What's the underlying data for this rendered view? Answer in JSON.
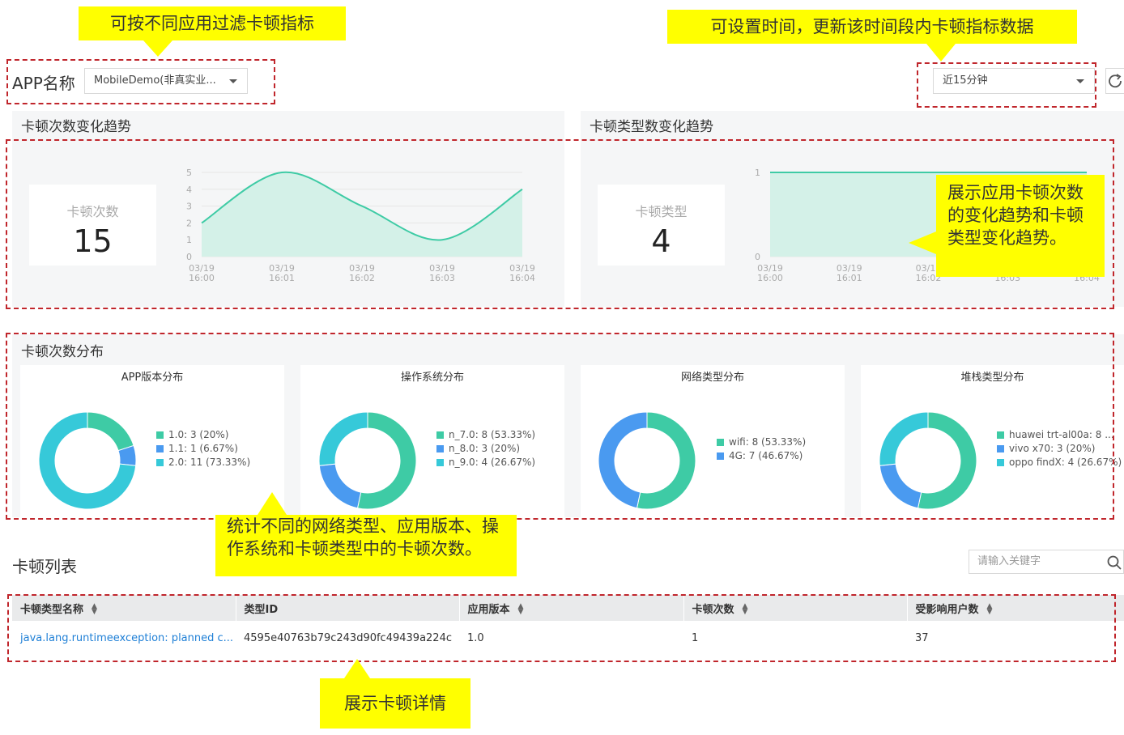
{
  "callouts": {
    "app_filter": "可按不同应用过滤卡顿指标",
    "time_filter": "可设置时间，更新该时间段内卡顿指标数据",
    "trends": "展示应用卡顿次数的变化趋势和卡顿类型变化趋势。",
    "distribution": "统计不同的网络类型、应用版本、操作系统和卡顿类型中的卡顿次数。",
    "details": "展示卡顿详情"
  },
  "header": {
    "app_label": "APP名称",
    "app_select": "MobileDemo(非真实业...",
    "time_select": "近15分钟",
    "refresh_icon": "refresh-icon"
  },
  "trend_count": {
    "title": "卡顿次数变化趋势",
    "kpi_label": "卡顿次数",
    "kpi_value": "15",
    "y_ticks": [
      "5",
      "4",
      "3",
      "2",
      "1",
      "0"
    ],
    "x_ticks": [
      {
        "date": "03/19",
        "time": "16:00"
      },
      {
        "date": "03/19",
        "time": "16:01"
      },
      {
        "date": "03/19",
        "time": "16:02"
      },
      {
        "date": "03/19",
        "time": "16:03"
      },
      {
        "date": "03/19",
        "time": "16:04"
      }
    ]
  },
  "trend_type": {
    "title": "卡顿类型数变化趋势",
    "kpi_label": "卡顿类型",
    "kpi_value": "4",
    "y_ticks": [
      "1",
      "0"
    ],
    "x_ticks": [
      {
        "date": "03/19",
        "time": "16:00"
      },
      {
        "date": "03/19",
        "time": "16:01"
      },
      {
        "date": "03/19",
        "time": "16:02"
      },
      {
        "date": "03/19",
        "time": "16:03"
      },
      {
        "date": "03/19",
        "time": "16:04"
      }
    ]
  },
  "distribution": {
    "title": "卡顿次数分布",
    "cards": [
      {
        "title": "APP版本分布",
        "legend": [
          "1.0: 3 (20%)",
          "1.1: 1 (6.67%)",
          "2.0: 11 (73.33%)"
        ]
      },
      {
        "title": "操作系统分布",
        "legend": [
          "n_7.0: 8 (53.33%)",
          "n_8.0: 3 (20%)",
          "n_9.0: 4 (26.67%)"
        ]
      },
      {
        "title": "网络类型分布",
        "legend": [
          "wifi: 8 (53.33%)",
          "4G: 7 (46.67%)"
        ]
      },
      {
        "title": "堆栈类型分布",
        "legend": [
          "huawei trt-al00a: 8 ...",
          "vivo x70: 3 (20%)",
          "oppo findX: 4 (26.67%)"
        ]
      }
    ]
  },
  "list": {
    "title": "卡顿列表",
    "search_placeholder": "请输入关键字",
    "columns": [
      "卡顿类型名称",
      "类型ID",
      "应用版本",
      "卡顿次数",
      "受影响用户数"
    ],
    "rows": [
      [
        "java.lang.runtimeexception: planned c...",
        "4595e40763b79c243d90fc49439a224c",
        "1.0",
        "1",
        "37"
      ]
    ]
  },
  "colors": {
    "teal": "#3ecba5",
    "blue": "#4a9af0",
    "cyan": "#36c9d9",
    "callout": "#ffff00",
    "frame": "#c0262c",
    "link": "#1e7fd6"
  },
  "chart_data": [
    {
      "type": "area",
      "title": "卡顿次数变化趋势",
      "x": [
        "03/19 16:00",
        "03/19 16:01",
        "03/19 16:02",
        "03/19 16:03",
        "03/19 16:04"
      ],
      "values": [
        2,
        5,
        3,
        1,
        4
      ],
      "ylim": [
        0,
        5
      ]
    },
    {
      "type": "area",
      "title": "卡顿类型数变化趋势",
      "x": [
        "03/19 16:00",
        "03/19 16:01",
        "03/19 16:02",
        "03/19 16:03",
        "03/19 16:04"
      ],
      "values": [
        1,
        1,
        1,
        1,
        1
      ],
      "ylim": [
        0,
        1
      ]
    },
    {
      "type": "pie",
      "title": "APP版本分布",
      "categories": [
        "1.0",
        "1.1",
        "2.0"
      ],
      "values": [
        3,
        1,
        11
      ],
      "colors": [
        "#3ecba5",
        "#4a9af0",
        "#36c9d9"
      ]
    },
    {
      "type": "pie",
      "title": "操作系统分布",
      "categories": [
        "n_7.0",
        "n_8.0",
        "n_9.0"
      ],
      "values": [
        8,
        3,
        4
      ],
      "colors": [
        "#3ecba5",
        "#4a9af0",
        "#36c9d9"
      ]
    },
    {
      "type": "pie",
      "title": "网络类型分布",
      "categories": [
        "wifi",
        "4G"
      ],
      "values": [
        8,
        7
      ],
      "colors": [
        "#3ecba5",
        "#4a9af0"
      ]
    },
    {
      "type": "pie",
      "title": "堆栈类型分布",
      "categories": [
        "huawei trt-al00a",
        "vivo x70",
        "oppo findX"
      ],
      "values": [
        8,
        3,
        4
      ],
      "colors": [
        "#3ecba5",
        "#4a9af0",
        "#36c9d9"
      ]
    }
  ]
}
